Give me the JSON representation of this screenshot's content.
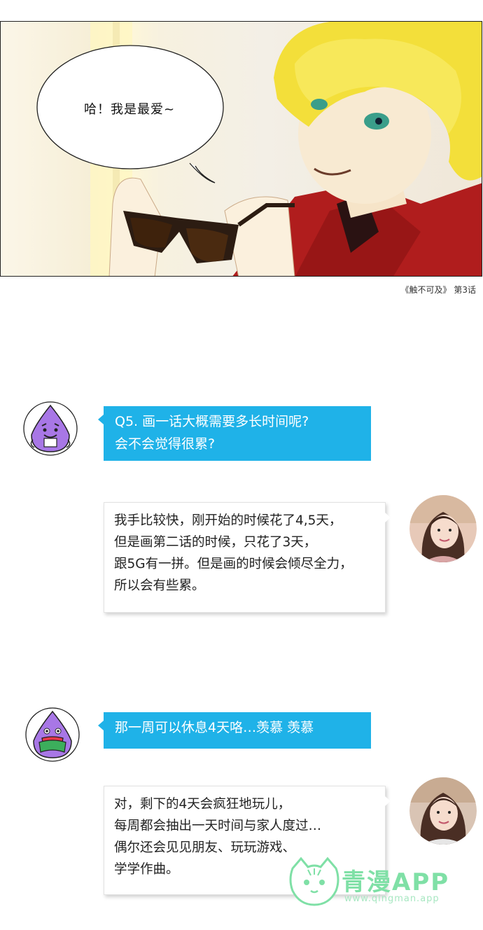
{
  "comic": {
    "speech": "哈！我是最爱~",
    "caption": "《触不可及》 第3话"
  },
  "chat": [
    {
      "role": "interviewer",
      "avatar_icon": "purple-mascot-icon",
      "lines": [
        "Q5. 画一话大概需要多长时间呢?",
        "会不会觉得很累?"
      ]
    },
    {
      "role": "author",
      "avatar_icon": "author-photo",
      "lines": [
        "我手比较快，刚开始的时候花了4,5天，",
        "但是画第二话的时候，只花了3天，",
        "跟5G有一拼。但是画的时候会倾尽全力，",
        "所以会有些累。"
      ]
    },
    {
      "role": "interviewer",
      "avatar_icon": "purple-mascot-icon",
      "lines": [
        "那一周可以休息4天咯…羡慕 羡慕"
      ]
    },
    {
      "role": "author",
      "avatar_icon": "author-photo",
      "lines": [
        "对，剩下的4天会疯狂地玩儿，",
        "每周都会抽出一天时间与家人度过…",
        "偶尔还会见见朋友、玩玩游戏、",
        "学学作曲。"
      ]
    }
  ],
  "watermark": {
    "brand": "青漫APP",
    "url": "www.qingman.app"
  },
  "colors": {
    "question_bubble": "#1fb2e8",
    "mascot": "#a877e6",
    "watermark": "#7fe0a6"
  }
}
